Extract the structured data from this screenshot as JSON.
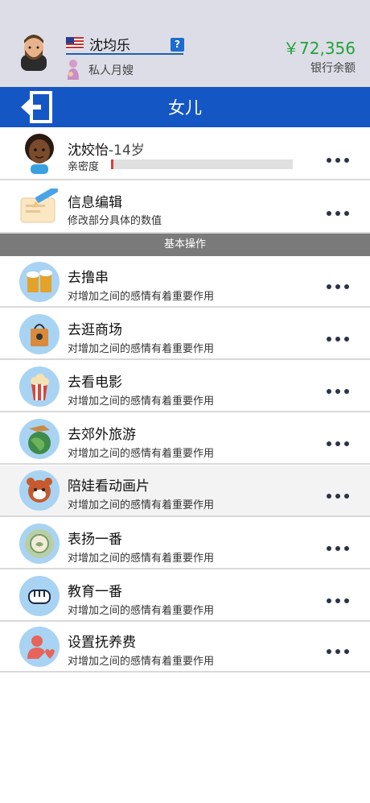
{
  "header": {
    "name": "沈均乐",
    "help_glyph": "?",
    "job": "私人月嫂",
    "money": "￥72,356",
    "balance_label": "银行余额"
  },
  "titlebar": {
    "title": "女儿"
  },
  "child": {
    "name": "沈姣怡",
    "age": "-14岁",
    "intimacy_label": "亲密度",
    "intimacy_value": 0.01
  },
  "info_edit": {
    "title": "信息编辑",
    "subtitle": "修改部分具体的数值"
  },
  "section": {
    "title": "基本操作"
  },
  "actions": [
    {
      "title": "去撸串",
      "subtitle": "对增加之间的感情有着重要作用",
      "icon": "beer-icon"
    },
    {
      "title": "去逛商场",
      "subtitle": "对增加之间的感情有着重要作用",
      "icon": "shopping-bag-icon"
    },
    {
      "title": "去看电影",
      "subtitle": "对增加之间的感情有着重要作用",
      "icon": "popcorn-icon"
    },
    {
      "title": "去郊外旅游",
      "subtitle": "对增加之间的感情有着重要作用",
      "icon": "globe-plane-icon"
    },
    {
      "title": "陪娃看动画片",
      "subtitle": "对增加之间的感情有着重要作用",
      "icon": "red-panda-icon"
    },
    {
      "title": "表扬一番",
      "subtitle": "对增加之间的感情有着重要作用",
      "icon": "praise-badge-icon"
    },
    {
      "title": "教育一番",
      "subtitle": "对增加之间的感情有着重要作用",
      "icon": "fist-icon"
    },
    {
      "title": "设置抚养费",
      "subtitle": "对增加之间的感情有着重要作用",
      "icon": "person-heart-icon"
    }
  ],
  "colors": {
    "header_bg": "#dcdde6",
    "titlebar_bg": "#1456c4",
    "money_green": "#22a33b",
    "section_bg": "#7a7a7a",
    "intimacy_fill": "#e23b3b"
  }
}
